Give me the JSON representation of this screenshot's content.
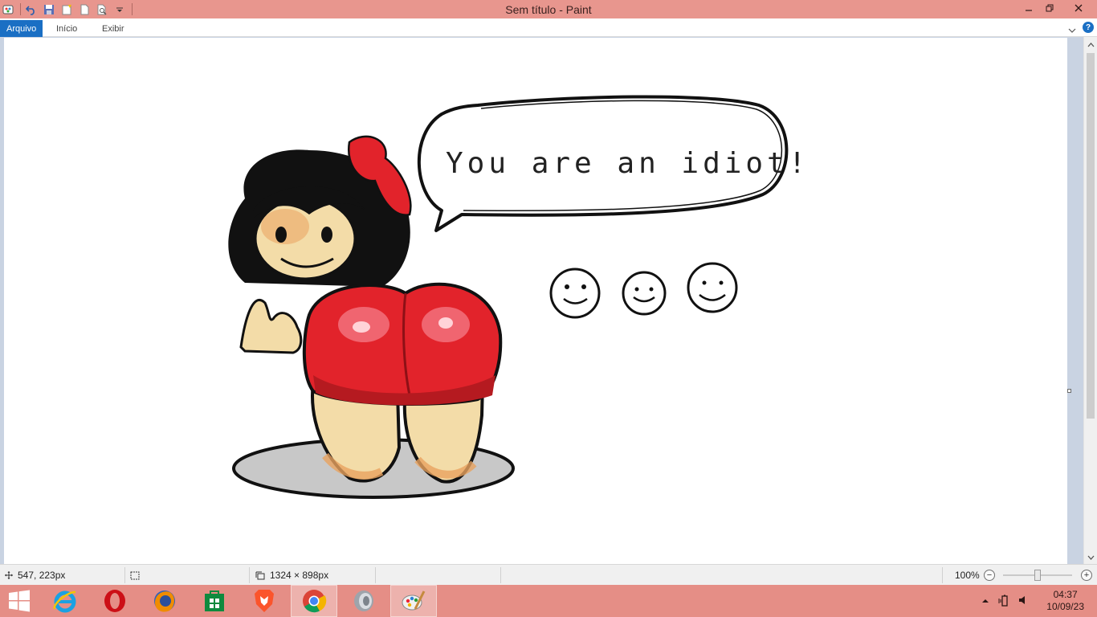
{
  "window": {
    "title": "Sem título - Paint"
  },
  "ribbon": {
    "tabs": [
      {
        "label": "Arquivo"
      },
      {
        "label": "Início"
      },
      {
        "label": "Exibir"
      }
    ]
  },
  "canvas_art": {
    "speech_text": "You are an idiot!"
  },
  "statusbar": {
    "cursor_position": "547, 223px",
    "selection_size": "",
    "image_size": "1324 × 898px",
    "zoom_level": "100%",
    "zoom_fraction": 0.5
  },
  "taskbar": {
    "apps": [
      {
        "name": "internet-explorer",
        "label": "Internet Explorer"
      },
      {
        "name": "opera",
        "label": "Opera"
      },
      {
        "name": "firefox",
        "label": "Firefox"
      },
      {
        "name": "store",
        "label": "Store"
      },
      {
        "name": "brave",
        "label": "Brave"
      },
      {
        "name": "chrome",
        "label": "Chrome"
      },
      {
        "name": "speaker-app",
        "label": "Speaker"
      },
      {
        "name": "paint",
        "label": "Paint"
      }
    ],
    "clock_time": "04:37",
    "clock_date": "10/09/23"
  },
  "colors": {
    "title_bar": "#e8968e",
    "taskbar": "#e58e86",
    "active_tab": "#1a6fc4",
    "dress_red": "#e2232b",
    "skin": "#f3dca8",
    "shadow_gray": "#c8c8c8"
  }
}
